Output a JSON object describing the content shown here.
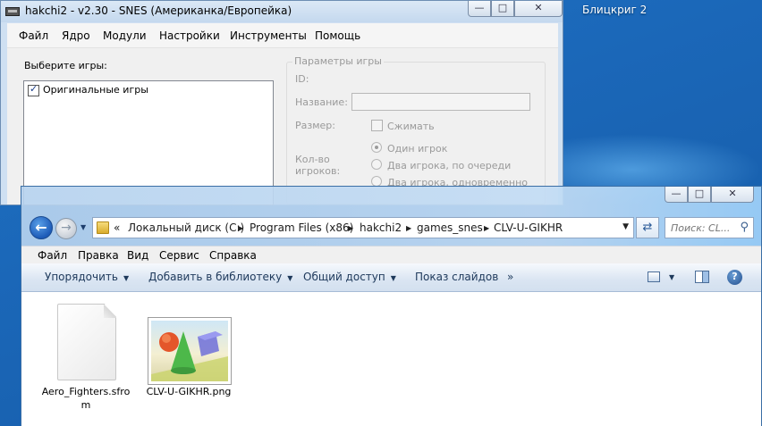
{
  "desktop": {
    "icon_label": "Блицкриг 2"
  },
  "hakchi": {
    "title": "hakchi2 - v2.30 - SNES (Американка/Европейка)",
    "menu": [
      "Файл",
      "Ядро",
      "Модули",
      "Настройки",
      "Инструменты",
      "Помощь"
    ],
    "select_games_label": "Выберите игры:",
    "games": [
      {
        "label": "Оригинальные игры",
        "checked": true
      }
    ],
    "params": {
      "title": "Параметры игры",
      "id_label": "ID:",
      "name_label": "Название:",
      "name_value": "",
      "size_label": "Размер:",
      "compress_label": "Сжимать",
      "players_label_line1": "Кол-во",
      "players_label_line2": "игроков:",
      "player_options": [
        "Один игрок",
        "Два игрока, по очереди",
        "Два игрока, одновременно"
      ],
      "selected_player_option": "Один игрок"
    },
    "window_buttons": {
      "minimize": "—",
      "maximize": "□",
      "close": "✕"
    }
  },
  "explorer": {
    "address": {
      "overflow": "«",
      "segments": [
        "Локальный диск (C:)",
        "Program Files (x86)",
        "hakchi2",
        "games_snes",
        "CLV-U-GIKHR"
      ]
    },
    "search_placeholder": "Поиск: CL...",
    "menu": [
      "Файл",
      "Правка",
      "Вид",
      "Сервис",
      "Справка"
    ],
    "commands": [
      "Упорядочить",
      "Добавить в библиотеку",
      "Общий доступ",
      "Показ слайдов"
    ],
    "more": "»",
    "files": [
      {
        "name": "Aero_Fighters.sfrom",
        "type": "document"
      },
      {
        "name": "CLV-U-GIKHR.png",
        "type": "image"
      }
    ],
    "window_buttons": {
      "minimize": "—",
      "maximize": "□",
      "close": "✕"
    },
    "colors": {
      "frame": "#c3dcf4",
      "command_bar": "#dae5f2",
      "accent": "#1d5bb8"
    }
  }
}
